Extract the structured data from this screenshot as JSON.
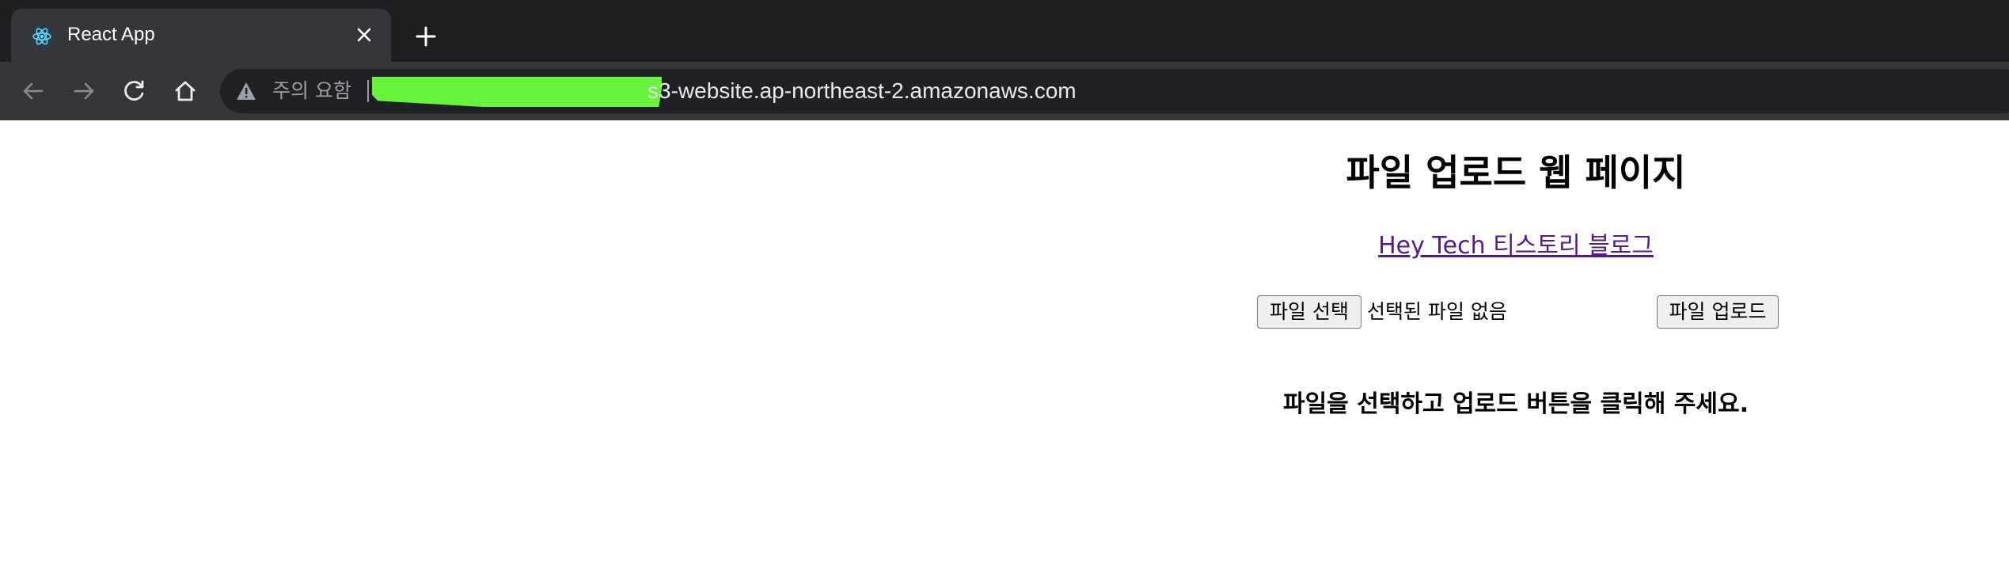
{
  "browser": {
    "tab": {
      "title": "React App",
      "favicon": "react-logo-icon",
      "close": "close-icon"
    },
    "new_tab": "plus-icon",
    "nav": {
      "back": "arrow-left-icon",
      "forward": "arrow-right-icon",
      "reload": "reload-icon",
      "home": "home-icon"
    },
    "address_bar": {
      "security_icon": "warning-triangle-icon",
      "security_label": "주의 요함",
      "url_visible": "s3-website.ap-northeast-2.amazonaws.com",
      "redaction_color": "#66f33a"
    }
  },
  "page": {
    "title": "파일 업로드 웹 페이지",
    "blog_link": "Hey Tech 티스토리 블로그",
    "file_input": {
      "button_label": "파일 선택",
      "status": "선택된 파일 없음"
    },
    "upload_button": "파일 업로드",
    "message": "파일을 선택하고 업로드 버튼을 클릭해 주세요."
  },
  "colors": {
    "tabbar": "#1f1f21",
    "toolbar": "#35363a",
    "link": "#551a8b"
  }
}
